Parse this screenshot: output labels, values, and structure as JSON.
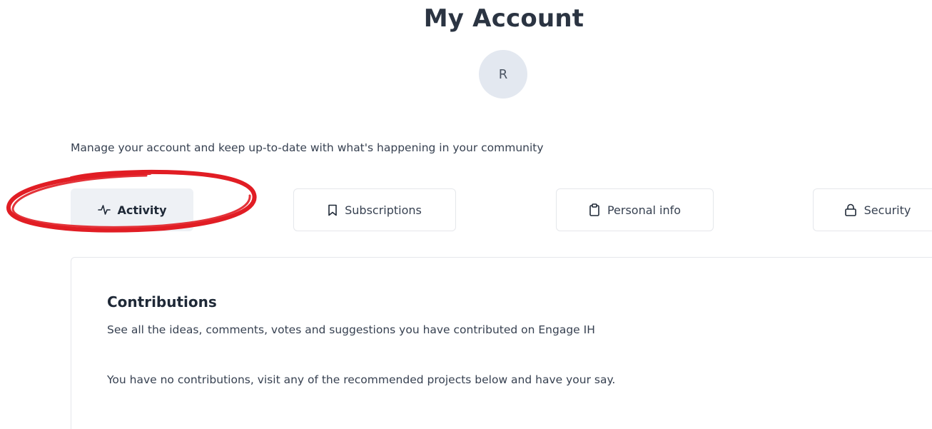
{
  "header": {
    "title": "My Account",
    "avatar_initial": "R"
  },
  "intro": "Manage your account and keep up-to-date with what's happening in your community",
  "tabs": [
    {
      "label": "Activity",
      "icon": "activity-icon",
      "active": true
    },
    {
      "label": "Subscriptions",
      "icon": "bookmark-icon",
      "active": false
    },
    {
      "label": "Personal info",
      "icon": "clipboard-icon",
      "active": false
    },
    {
      "label": "Security",
      "icon": "lock-icon",
      "active": false
    }
  ],
  "contributions": {
    "title": "Contributions",
    "description": "See all the ideas, comments, votes and suggestions you have contributed on Engage IH",
    "empty_message": "You have no contributions, visit any of the recommended projects below and have your say."
  },
  "colors": {
    "annotation_ring": "#e11d24",
    "active_tab_bg": "#eef1f5",
    "avatar_bg": "#e3e8f0"
  }
}
